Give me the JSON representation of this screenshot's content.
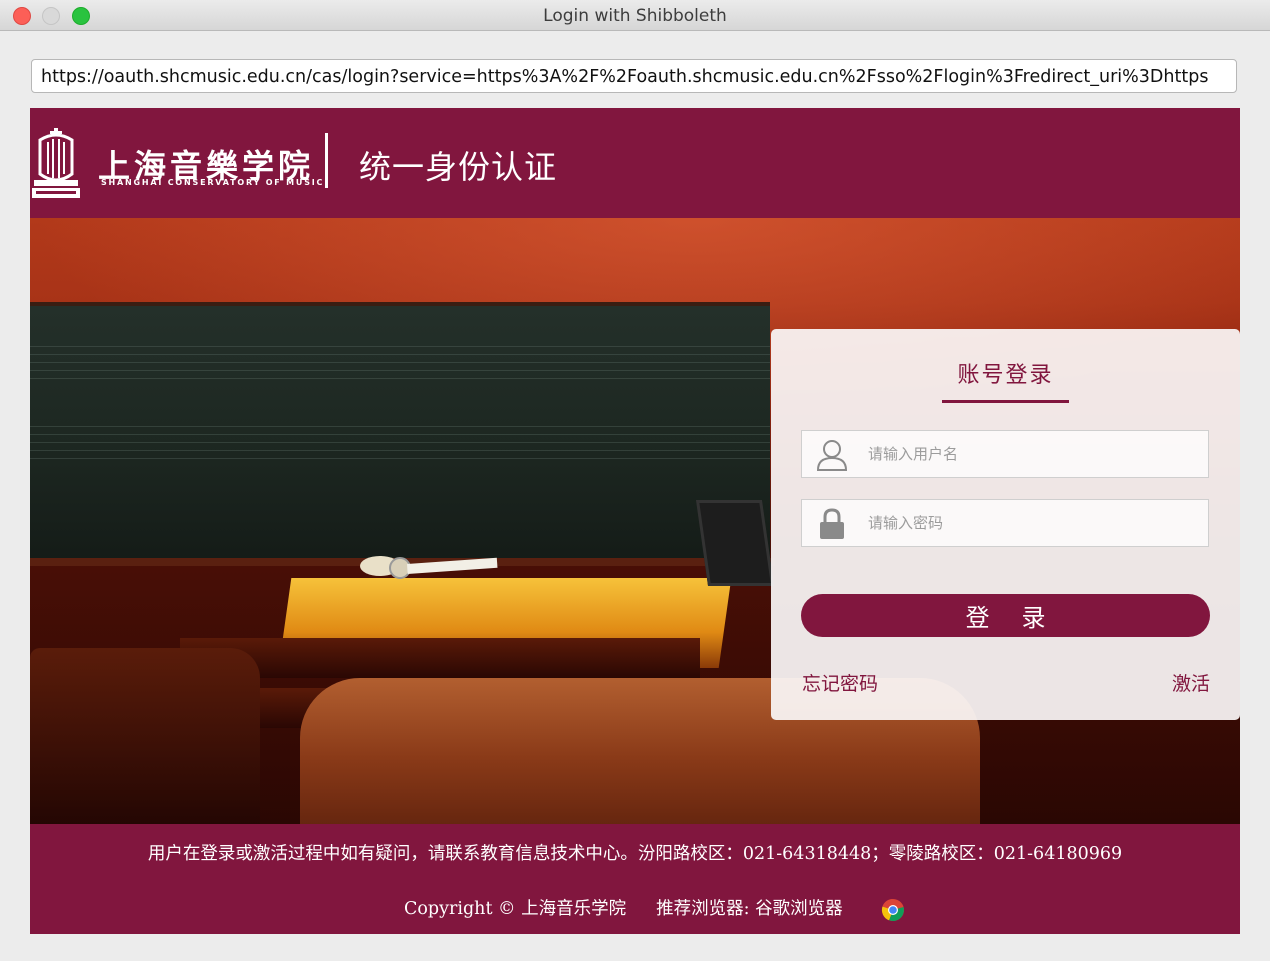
{
  "window": {
    "title": "Login with Shibboleth"
  },
  "url_bar": {
    "url": "https://oauth.shcmusic.edu.cn/cas/login?service=https%3A%2F%2Foauth.shcmusic.edu.cn%2Fsso%2Flogin%3Fredirect_uri%3Dhttps"
  },
  "header": {
    "logo_cn": "上海音樂学院",
    "logo_en": "SHANGHAI CONSERVATORY OF MUSIC",
    "title": "统一身份认证"
  },
  "login": {
    "tab_title": "账号登录",
    "username_placeholder": "请输入用户名",
    "password_placeholder": "请输入密码",
    "submit_label": "登录",
    "forgot_label": "忘记密码",
    "activate_label": "激活",
    "user_icon": "user-icon",
    "lock_icon": "lock-icon"
  },
  "footer": {
    "contact": "用户在登录或激活过程中如有疑问，请联系教育信息技术中心。汾阳路校区：021-64318448；零陵路校区：021-64180969",
    "copyright": "Copyright © 上海音乐学院",
    "browser_label": "推荐浏览器: 谷歌浏览器",
    "browser_icon": "chrome-icon"
  },
  "colors": {
    "brand": "#81163e",
    "page_bg": "#ececec"
  }
}
